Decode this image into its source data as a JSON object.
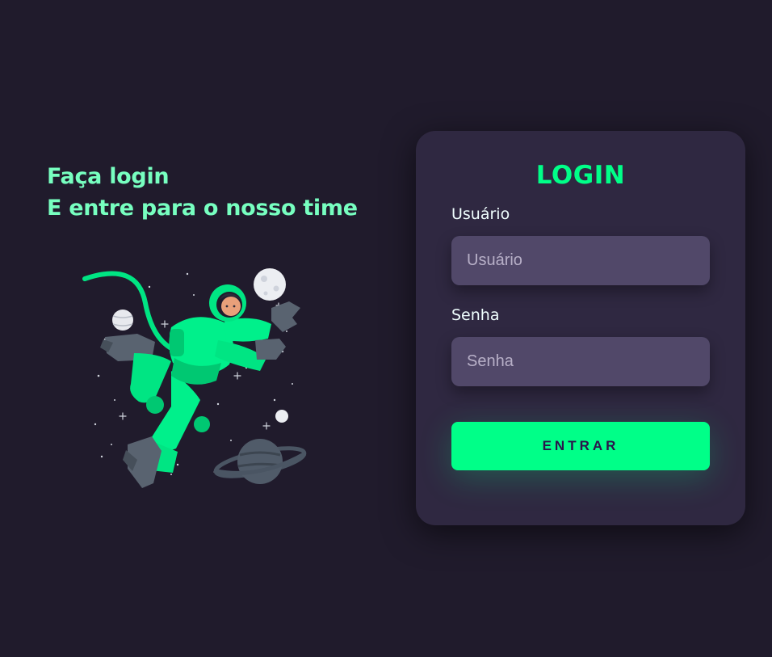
{
  "hero": {
    "line1": "Faça login",
    "line2": "E entre para o nosso time"
  },
  "illustration": {
    "icon": "astronaut-illustration"
  },
  "login": {
    "title": "LOGIN",
    "username_label": "Usuário",
    "username_placeholder": "Usuário",
    "username_value": "",
    "password_label": "Senha",
    "password_placeholder": "Senha",
    "password_value": "",
    "submit_label": "ENTRAR"
  },
  "colors": {
    "background": "#201b2c",
    "card": "#2f2841",
    "input": "#514869",
    "accent": "#00ff88",
    "hero_text": "#77ffc0"
  }
}
